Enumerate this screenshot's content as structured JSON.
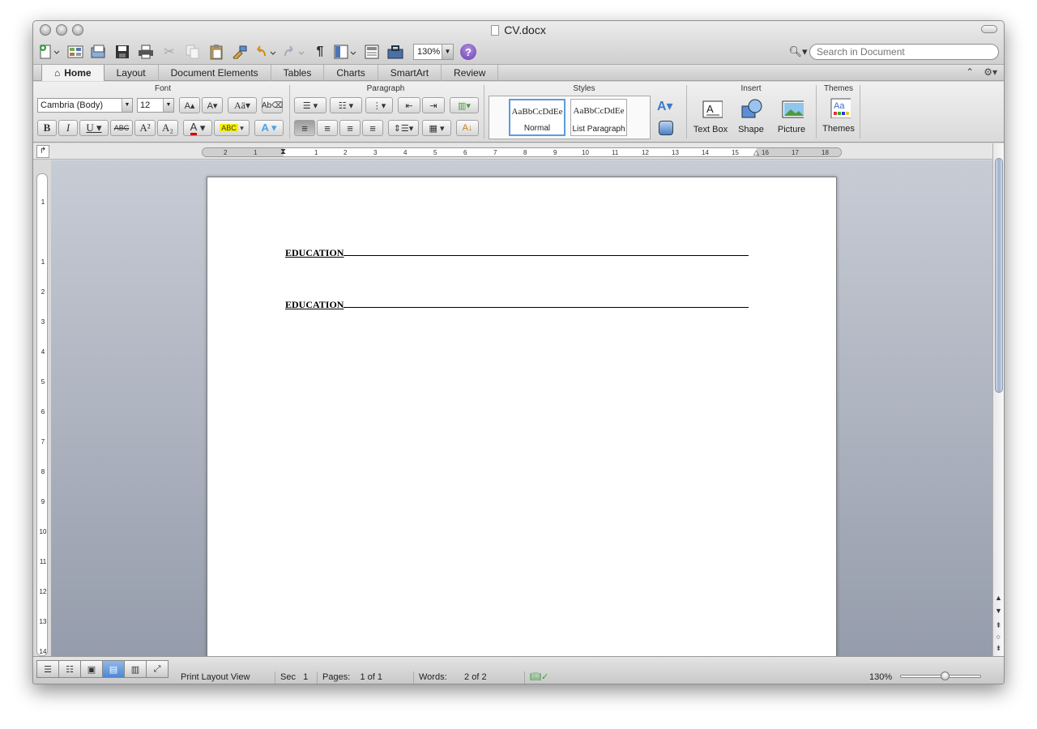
{
  "window": {
    "title": "CV.docx"
  },
  "toolbar": {
    "zoom_value": "130%",
    "search_placeholder": "Search in Document"
  },
  "tabs": [
    {
      "label": "Home",
      "active": true
    },
    {
      "label": "Layout"
    },
    {
      "label": "Document Elements"
    },
    {
      "label": "Tables"
    },
    {
      "label": "Charts"
    },
    {
      "label": "SmartArt"
    },
    {
      "label": "Review"
    }
  ],
  "ribbon": {
    "groups": {
      "font": "Font",
      "paragraph": "Paragraph",
      "styles": "Styles",
      "insert": "Insert",
      "themes": "Themes"
    },
    "font_name": "Cambria (Body)",
    "font_size": "12",
    "styles": [
      {
        "sample": "AaBbCcDdEe",
        "name": "Normal",
        "selected": true
      },
      {
        "sample": "AaBbCcDdEe",
        "name": "List Paragraph"
      }
    ],
    "insert_buttons": {
      "text_box": "Text Box",
      "shape": "Shape",
      "picture": "Picture"
    },
    "themes_button": "Themes"
  },
  "ruler": {
    "h_numbers": [
      "2",
      "1",
      "1",
      "2",
      "3",
      "4",
      "5",
      "6",
      "7",
      "8",
      "9",
      "10",
      "11",
      "12",
      "13",
      "14",
      "15",
      "16",
      "17",
      "18"
    ],
    "v_numbers": [
      "1",
      "1",
      "2",
      "3",
      "4",
      "5",
      "6",
      "7",
      "8",
      "9",
      "10",
      "11",
      "12",
      "13",
      "14"
    ]
  },
  "document": {
    "headings": [
      "EDUCATION",
      "EDUCATION"
    ]
  },
  "status": {
    "view": "Print Layout View",
    "sec_label": "Sec",
    "sec_value": "1",
    "pages_label": "Pages:",
    "pages_value": "1 of 1",
    "words_label": "Words:",
    "words_value": "2 of 2",
    "zoom": "130%"
  },
  "colors": {
    "selected_view": "#4c88d4",
    "style_selection": "#5d9bdc",
    "font_color_bar": "#d40000",
    "highlight_bar": "#f4f000"
  },
  "icons": {
    "new": "new-document-icon",
    "templates": "templates-icon",
    "open": "open-icon",
    "save": "save-icon",
    "print": "print-icon",
    "cut": "cut-icon",
    "copy": "copy-icon",
    "paste": "paste-icon",
    "format": "format-painter-icon",
    "undo": "undo-icon",
    "redo": "redo-icon",
    "pilcrow": "pilcrow-icon",
    "sidebar": "sidebar-icon",
    "gallery": "media-browser-icon",
    "toolbox": "toolbox-icon",
    "help": "help-icon",
    "search": "magnifier-icon"
  }
}
